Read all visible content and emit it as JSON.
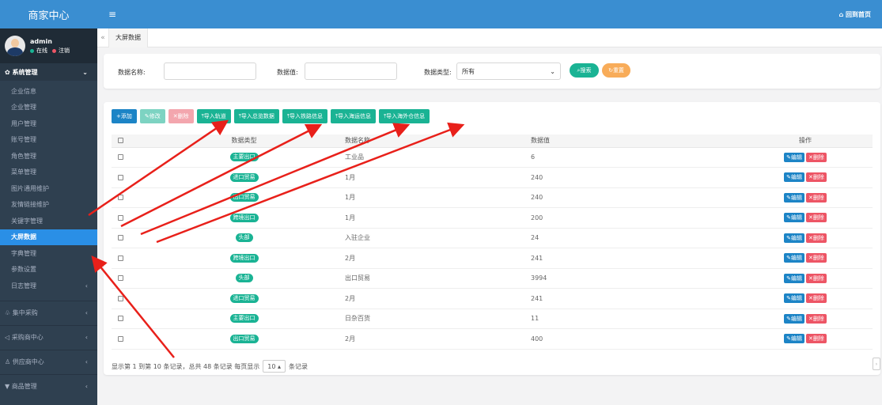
{
  "app": {
    "title": "商家中心",
    "home_link": "回到首页"
  },
  "user": {
    "name": "admin",
    "status_online": "在线",
    "logout": "注销"
  },
  "sidebar": {
    "group_title": "系统管理",
    "items": [
      {
        "label": "企业信息"
      },
      {
        "label": "企业管理"
      },
      {
        "label": "用户管理"
      },
      {
        "label": "账号管理"
      },
      {
        "label": "角色管理"
      },
      {
        "label": "菜单管理"
      },
      {
        "label": "图片通用维护"
      },
      {
        "label": "友情链接维护"
      },
      {
        "label": "关键字管理"
      },
      {
        "label": "大屏数据"
      },
      {
        "label": "字典管理"
      },
      {
        "label": "参数设置"
      },
      {
        "label": "日志管理"
      }
    ],
    "sections": [
      {
        "label": "集中采购"
      },
      {
        "label": "采购商中心"
      },
      {
        "label": "供应商中心"
      },
      {
        "label": "商品管理"
      }
    ]
  },
  "tabs": {
    "active": "大屏数据"
  },
  "search": {
    "name_label": "数据名称:",
    "value_label": "数据值:",
    "type_label": "数据类型:",
    "type_selected": "所有",
    "search_btn": "搜索",
    "reset_btn": "重置"
  },
  "toolbar": {
    "add": "添加",
    "edit": "修改",
    "delete": "删除",
    "import_rail": "导入轨道",
    "import_total": "导入总览数据",
    "import_railway": "导入铁路信息",
    "import_sea": "导入海运信息",
    "import_overseas": "导入海外仓信息"
  },
  "table": {
    "headers": [
      "数据类型",
      "数据名称",
      "数据值",
      "操作"
    ],
    "edit_btn": "编辑",
    "delete_btn": "删除",
    "rows": [
      {
        "type": "主要出口",
        "name": "工业品",
        "value": "6"
      },
      {
        "type": "进口贸易",
        "name": "1月",
        "value": "240"
      },
      {
        "type": "出口贸易",
        "name": "1月",
        "value": "240"
      },
      {
        "type": "跨境出口",
        "name": "1月",
        "value": "200"
      },
      {
        "type": "头部",
        "name": "入驻企业",
        "value": "24"
      },
      {
        "type": "跨境出口",
        "name": "2月",
        "value": "241"
      },
      {
        "type": "头部",
        "name": "出口贸易",
        "value": "3994"
      },
      {
        "type": "进口贸易",
        "name": "2月",
        "value": "241"
      },
      {
        "type": "主要出口",
        "name": "日杂百货",
        "value": "11"
      },
      {
        "type": "出口贸易",
        "name": "2月",
        "value": "400"
      }
    ]
  },
  "pager": {
    "summary": "显示第 1 到第 10 条记录，总共 48 条记录 每页显示",
    "page_size": "10",
    "suffix": "条记录"
  },
  "colors": {
    "header_blue": "#3a8ed1",
    "sidebar": "#2f4050",
    "green": "#1ab394",
    "primary": "#1c84c6",
    "danger": "#ed5565",
    "warning": "#f8ac59",
    "annotation": "#e8201a"
  }
}
